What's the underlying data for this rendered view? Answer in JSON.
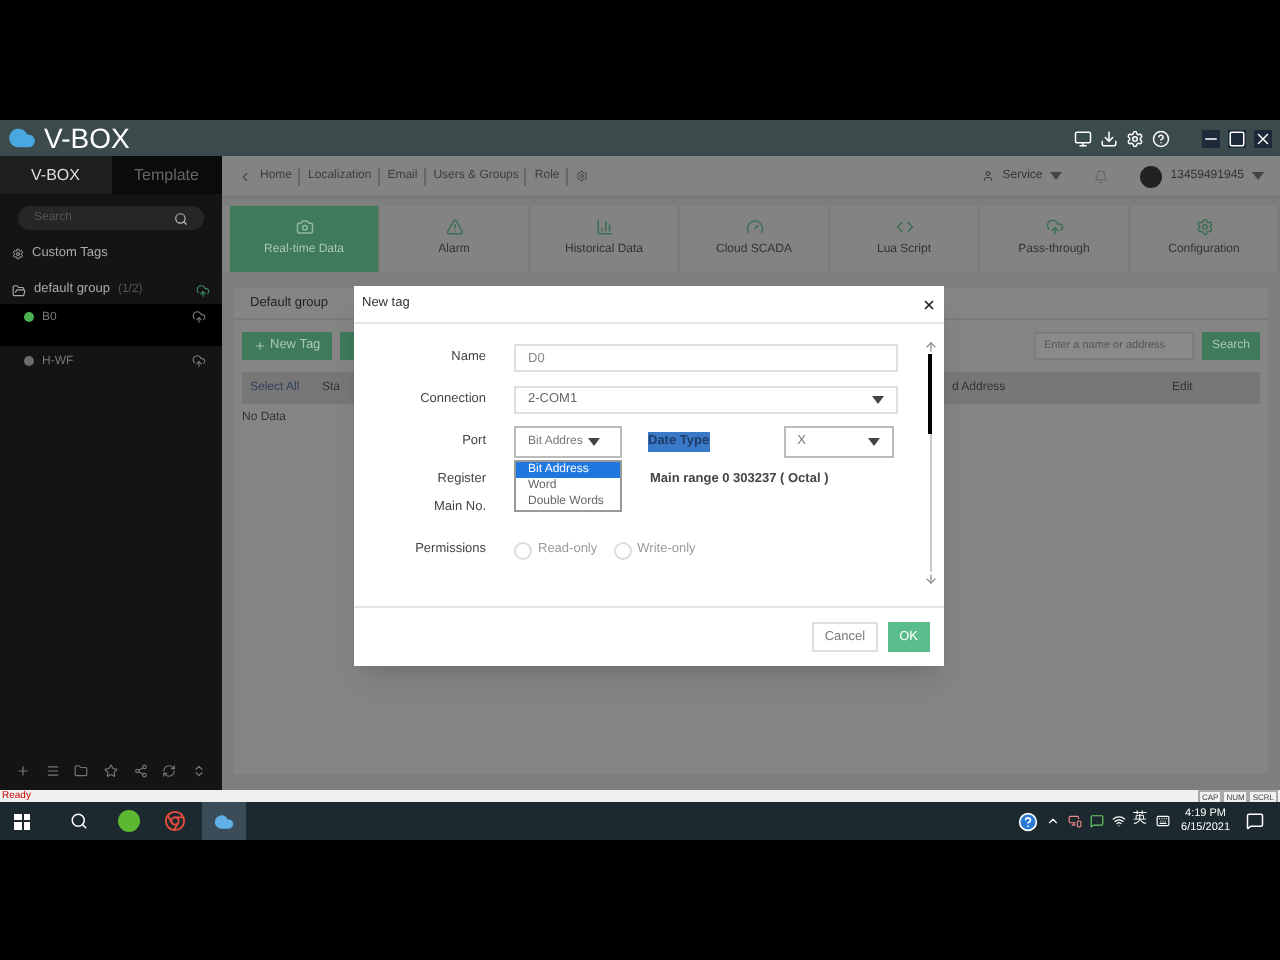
{
  "app": {
    "title": "V-BOX"
  },
  "sidebar": {
    "tabs": [
      {
        "label": "V-BOX",
        "selected": true
      },
      {
        "label": "Template",
        "selected": false
      }
    ],
    "search": {
      "placeholder": "Search"
    },
    "custom_tags": "Custom Tags",
    "group": {
      "label": "default group",
      "count": "(1/2)",
      "expanded": true,
      "items": [
        {
          "name": "B0",
          "color": "#4caf50",
          "selected": true
        },
        {
          "name": "H-WF",
          "color": "#6b6b6b",
          "selected": false
        }
      ]
    }
  },
  "breadcrumb": [
    "Home",
    "Localization",
    "Email",
    "Users & Groups",
    "Role"
  ],
  "header": {
    "service": "Service",
    "account": "13459491945"
  },
  "toolbar": [
    {
      "label": "Real-time Data",
      "selected": true
    },
    {
      "label": "Alarm",
      "selected": false
    },
    {
      "label": "Historical Data",
      "selected": false
    },
    {
      "label": "Cloud SCADA",
      "selected": false
    },
    {
      "label": "Lua Script",
      "selected": false
    },
    {
      "label": "Pass-through",
      "selected": false
    },
    {
      "label": "Configuration",
      "selected": false
    }
  ],
  "content": {
    "group_tab": "Default group",
    "new_tag": "New Tag",
    "search": {
      "placeholder": "Enter a name or address",
      "button": "Search"
    },
    "columns": [
      "Select All",
      "Sta",
      "d Address",
      "Edit"
    ],
    "empty": "No Data"
  },
  "dialog": {
    "title": "New tag",
    "name": {
      "label": "Name",
      "value": "D0"
    },
    "connection": {
      "label": "Connection",
      "value": "2-COM1"
    },
    "port": {
      "label": "Port",
      "value": "Bit Addres",
      "expanded": true,
      "options": [
        {
          "label": "Bit Address",
          "selected": true
        },
        {
          "label": "Word",
          "selected": false
        },
        {
          "label": "Double Words",
          "selected": false
        }
      ]
    },
    "data_type": {
      "label": "Date Type",
      "highlighted": true,
      "value": "X"
    },
    "register": {
      "label": "Register"
    },
    "main_no": {
      "label": "Main No.",
      "range": "Main range 0 303237 ( Octal )"
    },
    "permissions": {
      "label": "Permissions",
      "options": [
        {
          "label": "Read-only",
          "selected": false
        },
        {
          "label": "Write-only",
          "selected": false
        }
      ]
    },
    "cancel": "Cancel",
    "ok": "OK"
  },
  "status_bar": {
    "left": "Ready",
    "right": [
      "CAP",
      "NUM",
      "SCRL"
    ]
  },
  "taskbar": {
    "ime": "英",
    "time": "4:19 PM",
    "date": "6/15/2021"
  }
}
